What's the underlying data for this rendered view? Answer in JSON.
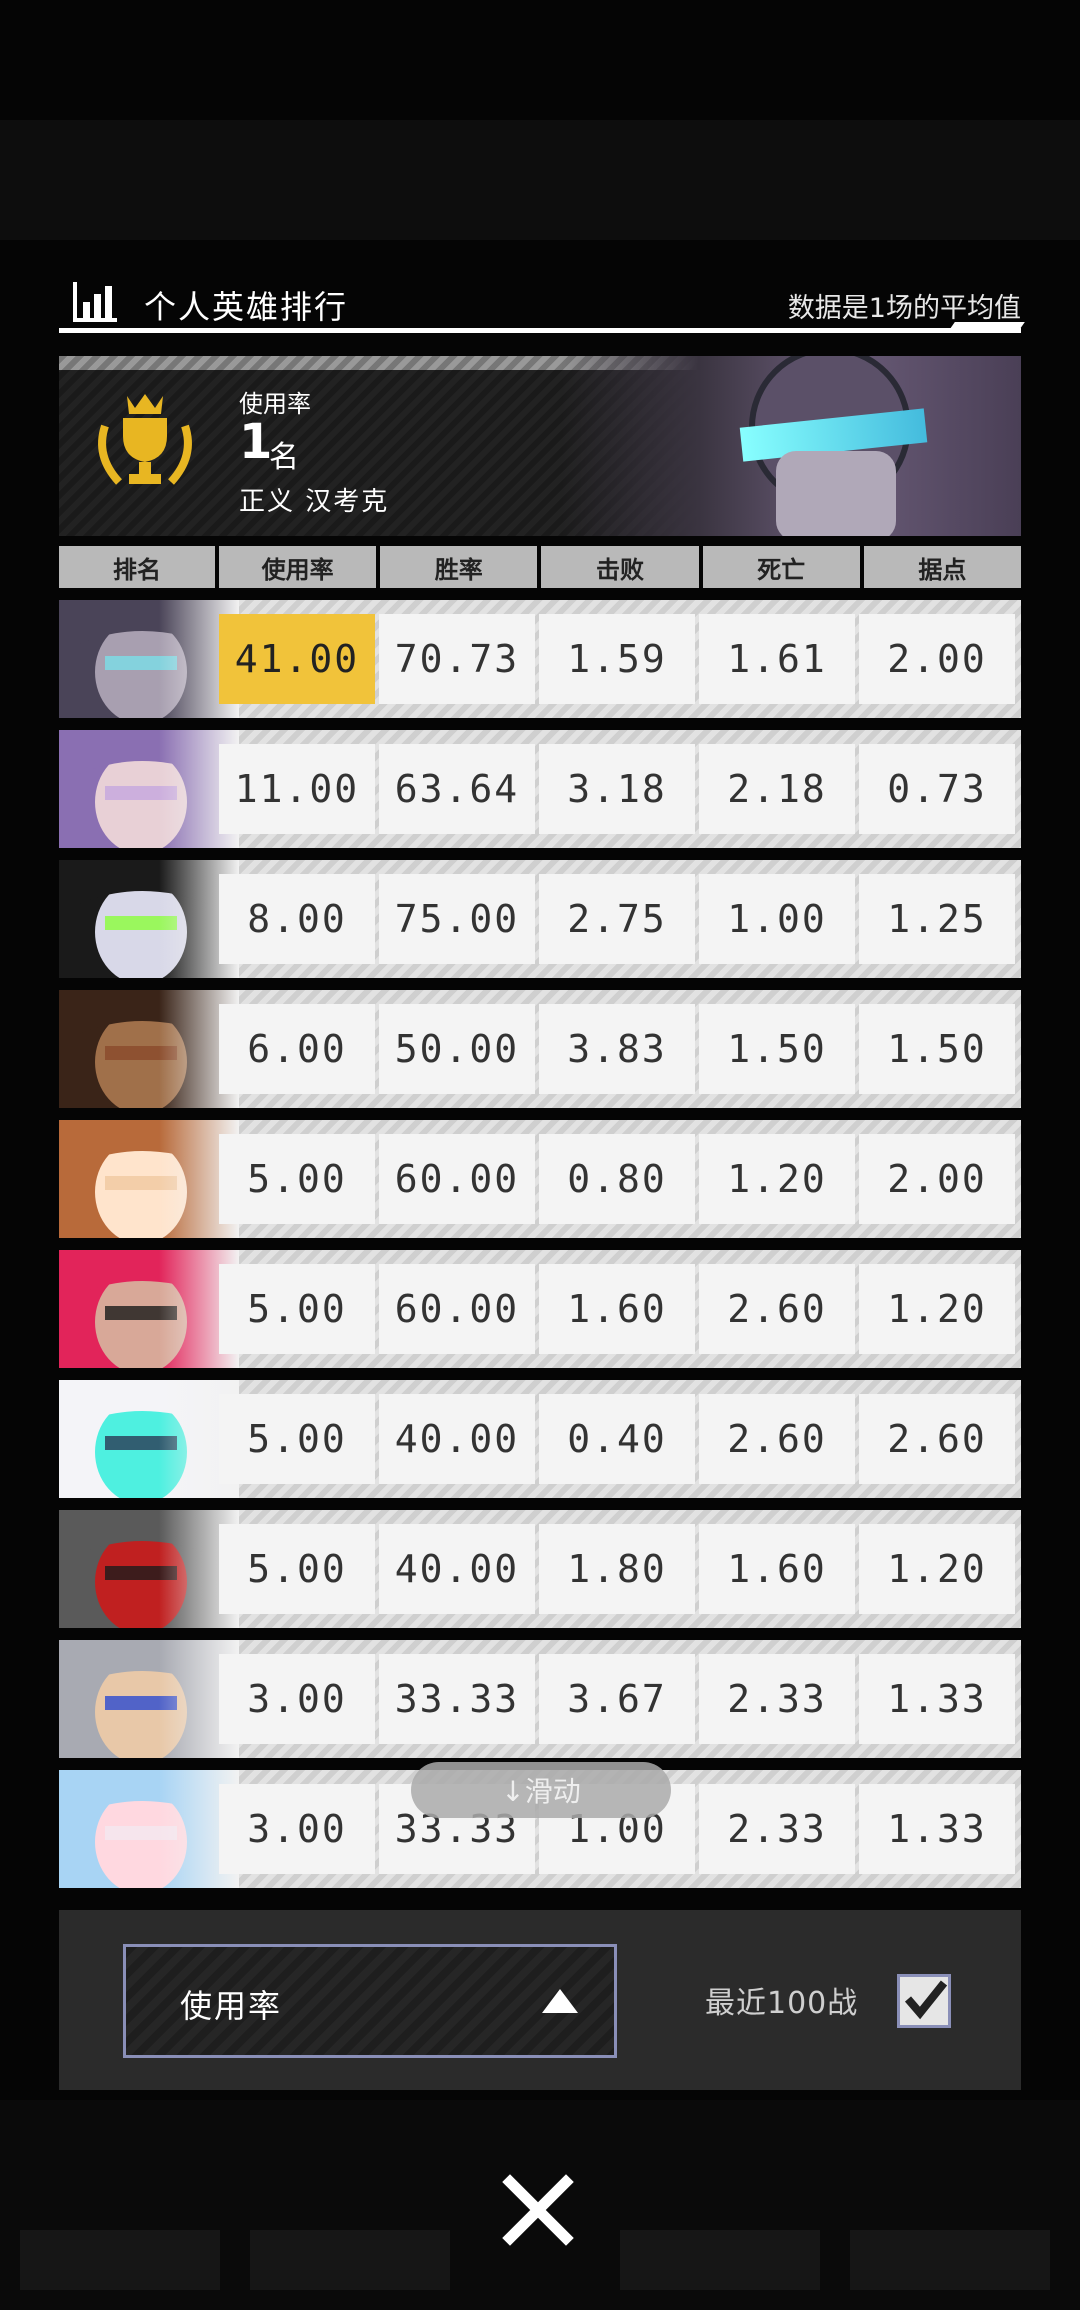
{
  "header": {
    "title": "个人英雄排行",
    "note": "数据是1场的平均值"
  },
  "banner": {
    "rank_label": "使用率",
    "rank_number": "1",
    "rank_unit": "名",
    "hero_name": "正义 汉考克"
  },
  "table": {
    "columns": [
      "排名",
      "使用率",
      "胜率",
      "击败",
      "死亡",
      "据点"
    ],
    "rows": [
      {
        "avatar": "hero-helmet-visor",
        "values": [
          "41.00",
          "70.73",
          "1.59",
          "1.61",
          "2.00"
        ],
        "highlight": true
      },
      {
        "avatar": "hero-purple-hair",
        "values": [
          "11.00",
          "63.64",
          "3.18",
          "2.18",
          "0.73"
        ]
      },
      {
        "avatar": "hero-black-hair-green",
        "values": [
          "8.00",
          "75.00",
          "2.75",
          "1.00",
          "1.25"
        ]
      },
      {
        "avatar": "hero-bandana",
        "values": [
          "6.00",
          "50.00",
          "3.83",
          "1.50",
          "1.50"
        ]
      },
      {
        "avatar": "hero-brown-hair-girl",
        "values": [
          "5.00",
          "60.00",
          "0.80",
          "1.20",
          "2.00"
        ]
      },
      {
        "avatar": "hero-glasses-pink",
        "values": [
          "5.00",
          "60.00",
          "1.60",
          "2.60",
          "1.20"
        ]
      },
      {
        "avatar": "hero-robot-white",
        "values": [
          "5.00",
          "40.00",
          "0.40",
          "2.60",
          "2.60"
        ]
      },
      {
        "avatar": "hero-mask-gray",
        "values": [
          "5.00",
          "40.00",
          "1.80",
          "1.60",
          "1.20"
        ]
      },
      {
        "avatar": "hero-silver-hair",
        "values": [
          "3.00",
          "33.33",
          "3.67",
          "2.33",
          "1.33"
        ]
      },
      {
        "avatar": "hero-blue-hair-girl",
        "values": [
          "3.00",
          "33.33",
          "1.00",
          "2.33",
          "1.33"
        ]
      }
    ]
  },
  "scroll_hint": "↓滑动",
  "footer": {
    "sort_select": "使用率",
    "recent_label": "最近100战",
    "recent_checked": true
  },
  "colors": {
    "highlight": "#f1c33a",
    "trophy": "#e8b622",
    "accent_border": "#8a8fb8"
  }
}
